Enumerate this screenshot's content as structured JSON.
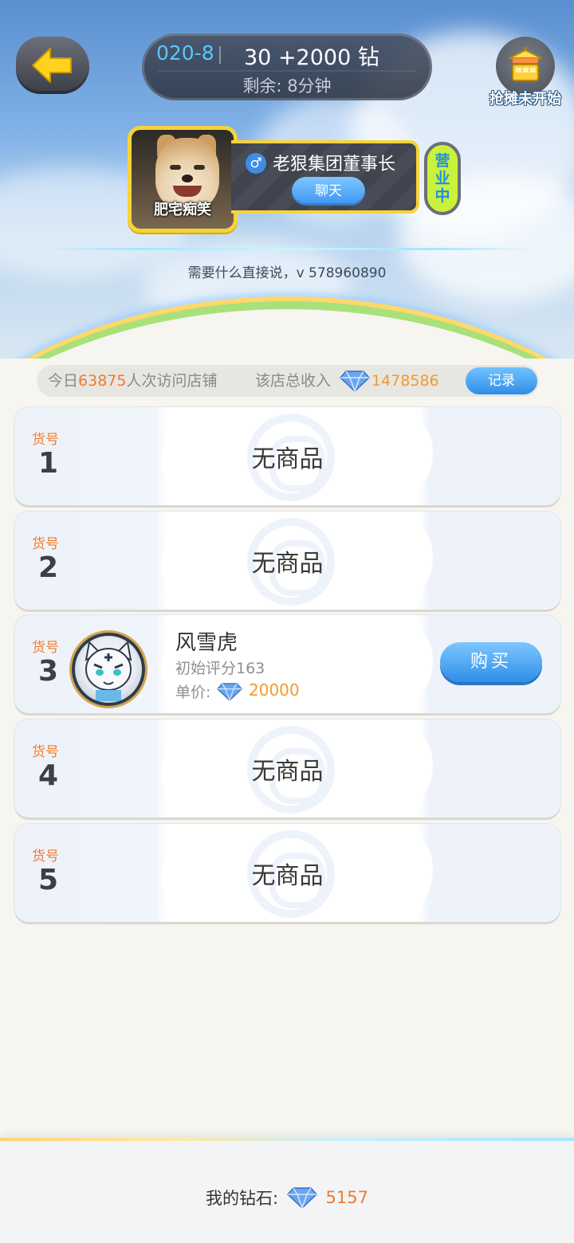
{
  "header": {
    "shop_code": "020-8",
    "price_text": "30 +2000 钻",
    "remaining_text": "剩余: 8分钟",
    "stall_label": "抢摊未开始"
  },
  "owner": {
    "photo_caption": "肥宅痴笑",
    "gender_symbol": "♂",
    "name": "老狠集团董事长",
    "chat_label": "聊天",
    "status_badge": [
      "营",
      "业",
      "中"
    ],
    "motto": "需要什么直接说，v   578960890"
  },
  "stats": {
    "visits_prefix": "今日",
    "visits_count": "63875",
    "visits_suffix": "人次访问店铺",
    "income_label": "该店总收入",
    "income_value": "1478586",
    "record_label": "记录"
  },
  "slots": [
    {
      "tag": "货号",
      "number": "1",
      "empty_label": "无商品"
    },
    {
      "tag": "货号",
      "number": "2",
      "empty_label": "无商品"
    },
    {
      "tag": "货号",
      "number": "3",
      "pet_name": "风雪虎",
      "pet_score": "初始评分163",
      "price_label": "单价:",
      "price_value": "20000",
      "buy_label": "购买"
    },
    {
      "tag": "货号",
      "number": "4",
      "empty_label": "无商品"
    },
    {
      "tag": "货号",
      "number": "5",
      "empty_label": "无商品"
    }
  ],
  "footer": {
    "wallet_label": "我的钻石:",
    "wallet_value": "5157"
  },
  "icons": {
    "back": "arrow-left-icon",
    "stall": "stall-cart-icon",
    "diamond": "diamond-icon"
  },
  "colors": {
    "accent_orange": "#f07a2d",
    "accent_blue": "#2f8ee8",
    "badge_yellow": "#f7d33a"
  }
}
